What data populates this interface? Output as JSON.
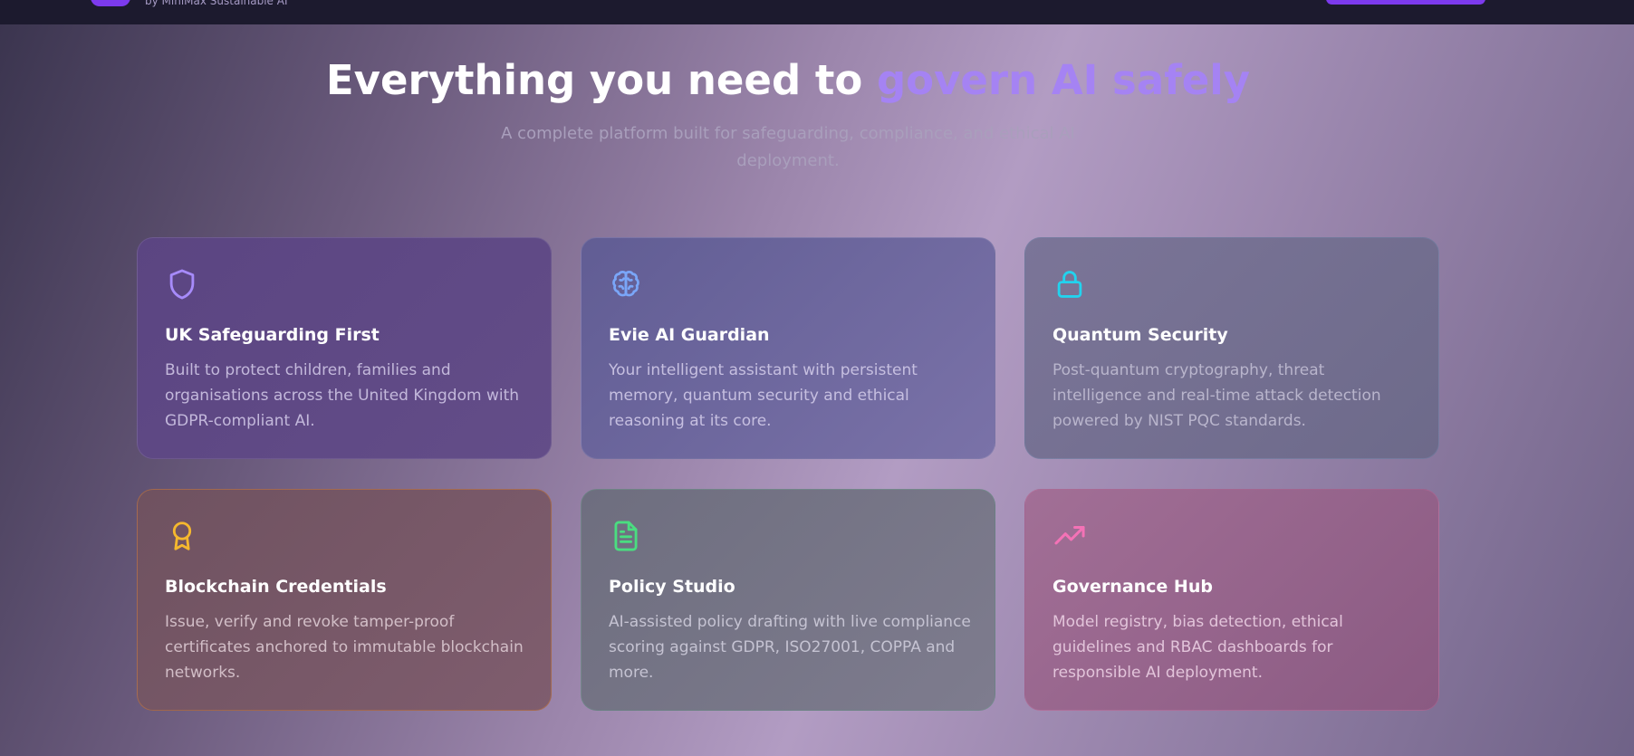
{
  "header": {
    "brand_subtitle": "by MiniMax Sustainable AI"
  },
  "hero": {
    "title_prefix": "Everything you need to ",
    "title_accent": "govern AI safely",
    "subtitle": "A complete platform built for safeguarding, compliance, and ethical AI deployment."
  },
  "features": [
    {
      "icon": "shield-icon",
      "title": "UK Safeguarding First",
      "description": "Built to protect children, families and organisations across the United Kingdom with GDPR-compliant AI."
    },
    {
      "icon": "brain-icon",
      "title": "Evie AI Guardian",
      "description": "Your intelligent assistant with persistent memory, quantum security and ethical reasoning at its core."
    },
    {
      "icon": "lock-icon",
      "title": "Quantum Security",
      "description": "Post-quantum cryptography, threat intelligence and real-time attack detection powered by NIST PQC standards."
    },
    {
      "icon": "award-icon",
      "title": "Blockchain Credentials",
      "description": "Issue, verify and revoke tamper-proof certificates anchored to immutable blockchain networks."
    },
    {
      "icon": "document-icon",
      "title": "Policy Studio",
      "description": "AI-assisted policy drafting with live compliance scoring against GDPR, ISO27001, COPPA and more."
    },
    {
      "icon": "trending-up-icon",
      "title": "Governance Hub",
      "description": "Model registry, bias detection, ethical guidelines and RBAC dashboards for responsible AI deployment."
    }
  ],
  "colors": {
    "accent": "#a583f3",
    "brand_purple": "#7c3aed",
    "shield_icon": "#a78bfa",
    "brain_icon": "#7aa6f8",
    "lock_icon": "#22d3ee",
    "award_icon": "#f5b82e",
    "document_icon": "#4ade80",
    "trending_icon": "#f472b6"
  }
}
